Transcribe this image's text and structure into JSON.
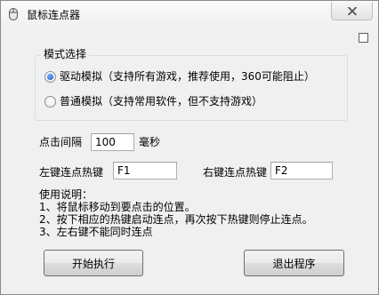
{
  "window": {
    "title": "鼠标连点器",
    "icon": "mouse-icon",
    "close_icon": "close-icon"
  },
  "mode": {
    "group_title": "模式选择",
    "options": [
      {
        "label": "驱动模拟（支持所有游戏，推荐使用，360可能阻止）",
        "checked": true
      },
      {
        "label": "普通模拟（支持常用软件，但不支持游戏）",
        "checked": false
      }
    ]
  },
  "interval": {
    "label": "点击间隔",
    "value": "100",
    "unit": "毫秒"
  },
  "hotkeys": {
    "left_label": "左键连点热键",
    "left_value": "F1",
    "right_label": "右键连点热键",
    "right_value": "F2"
  },
  "instructions": {
    "title": "使用说明：",
    "lines": [
      "1、将鼠标移动到要点击的位置。",
      "2、按下相应的热键启动连点，再次按下热键则停止连点。",
      "3、左右键不能同时连点"
    ]
  },
  "buttons": {
    "start": "开始执行",
    "exit": "退出程序"
  }
}
